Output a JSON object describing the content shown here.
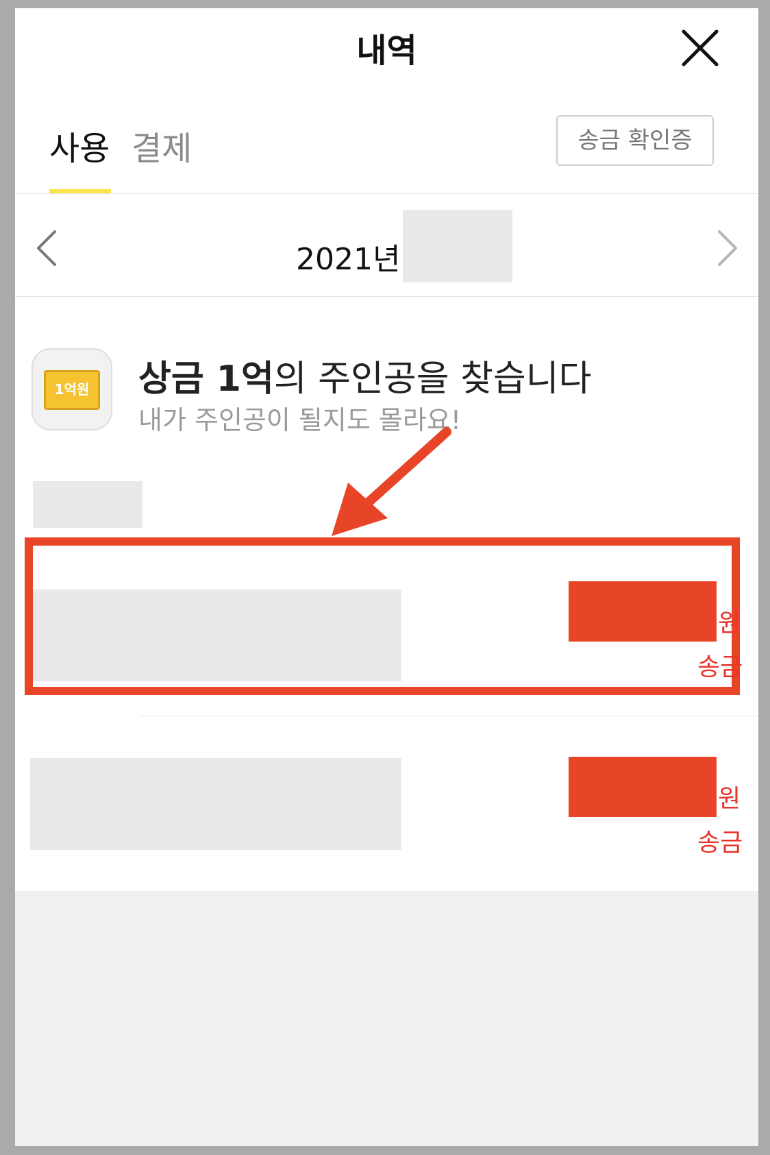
{
  "header": {
    "title": "내역"
  },
  "icons": {
    "close": "close-icon",
    "prev": "chevron-left-icon",
    "next": "chevron-right-icon"
  },
  "tabs": [
    {
      "label": "사용",
      "active": true
    },
    {
      "label": "결제",
      "active": false
    }
  ],
  "receipt_button": {
    "label": "송금 확인증"
  },
  "month_nav": {
    "year_label": "2021년"
  },
  "banner": {
    "ticket_text": "1억원",
    "title_bold": "상금 1억",
    "title_rest": "의 주인공을 찾습니다",
    "subtitle": "내가 주인공이 될지도 몰라요!"
  },
  "transactions": [
    {
      "unit": "원",
      "type": "송금",
      "highlighted": true
    },
    {
      "unit": "원",
      "type": "송금",
      "highlighted": false
    }
  ],
  "colors": {
    "accent_yellow": "#fbe64d",
    "highlight_red": "#e84528",
    "amount_red": "#e8352a"
  }
}
